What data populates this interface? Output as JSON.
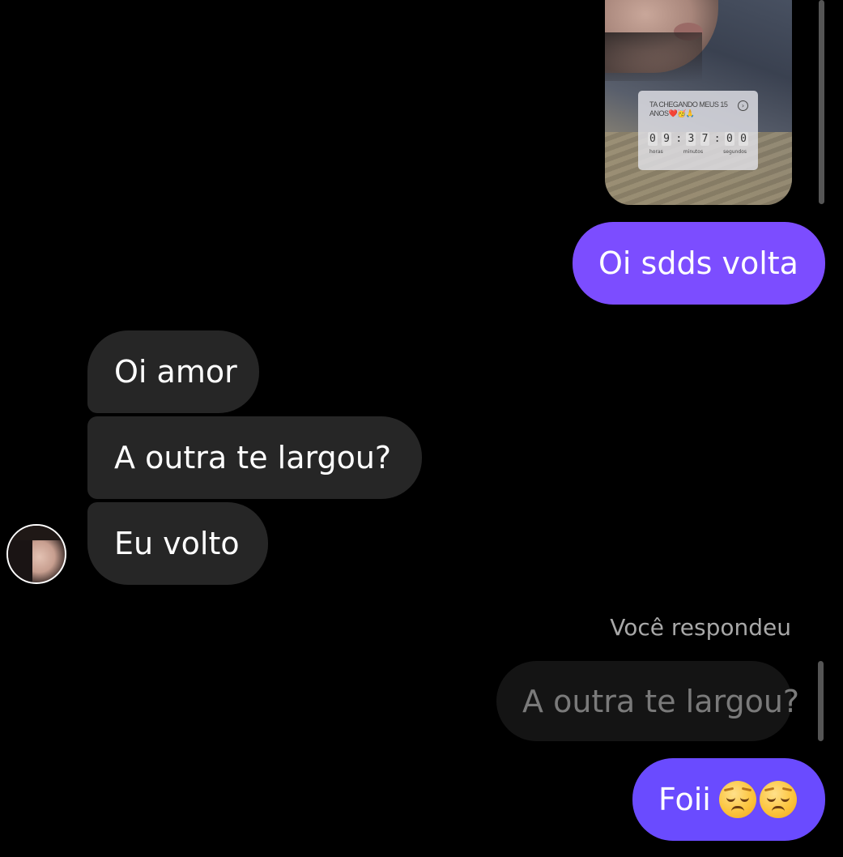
{
  "story_reply": {
    "countdown_title": "TA CHEGANDO MEUS 15 ANOS❤️🥳🙏",
    "countdown_digits": [
      "0",
      "9",
      ":",
      "3",
      "7",
      ":",
      "0",
      "0"
    ],
    "unit_hours": "horas",
    "unit_minutes": "minutos",
    "unit_seconds": "segundos"
  },
  "messages": {
    "sent_1": "Oi sdds volta",
    "recv_1": "Oi amor",
    "recv_2": "A outra te largou?",
    "recv_3": "Eu volto",
    "reply_meta": "Você respondeu",
    "reply_quote": "A outra te largou?",
    "sent_2": "Foii"
  },
  "emoji": [
    "pensive-face-emoji",
    "pensive-face-emoji"
  ],
  "colors": {
    "sent_bubble": "#7c4dff",
    "received_bubble": "#262626",
    "background": "#000000"
  }
}
